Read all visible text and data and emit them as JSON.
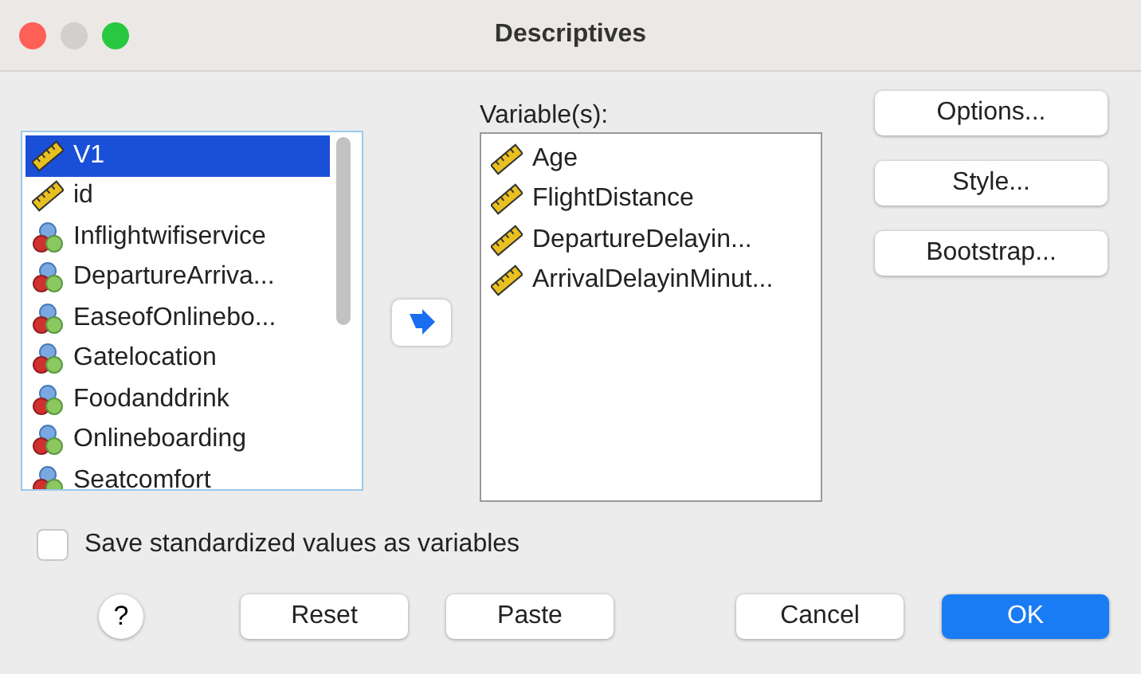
{
  "window": {
    "title": "Descriptives"
  },
  "source_list": {
    "items": [
      {
        "label": "V1",
        "kind": "scale",
        "selected": true
      },
      {
        "label": "id",
        "kind": "scale",
        "selected": false
      },
      {
        "label": "Inflightwifiservice",
        "kind": "nominal",
        "selected": false
      },
      {
        "label": "DepartureArriva...",
        "kind": "nominal",
        "selected": false
      },
      {
        "label": "EaseofOnlinebo...",
        "kind": "nominal",
        "selected": false
      },
      {
        "label": "Gatelocation",
        "kind": "nominal",
        "selected": false
      },
      {
        "label": "Foodanddrink",
        "kind": "nominal",
        "selected": false
      },
      {
        "label": "Onlineboarding",
        "kind": "nominal",
        "selected": false
      },
      {
        "label": "Seatcomfort",
        "kind": "nominal",
        "selected": false
      }
    ]
  },
  "variables": {
    "label": "Variable(s):",
    "items": [
      {
        "label": "Age",
        "kind": "scale"
      },
      {
        "label": "FlightDistance",
        "kind": "scale"
      },
      {
        "label": "DepartureDelayin...",
        "kind": "scale"
      },
      {
        "label": "ArrivalDelayinMinut...",
        "kind": "scale"
      }
    ]
  },
  "side_buttons": [
    "Options...",
    "Style...",
    "Bootstrap..."
  ],
  "save_option": {
    "label": "Save standardized values as variables",
    "checked": false
  },
  "footer": {
    "help": "?",
    "buttons": [
      {
        "label": "Reset",
        "kind": "normal"
      },
      {
        "label": "Paste",
        "kind": "normal"
      },
      {
        "label": "Cancel",
        "kind": "normal"
      },
      {
        "label": "OK",
        "kind": "default"
      }
    ]
  }
}
